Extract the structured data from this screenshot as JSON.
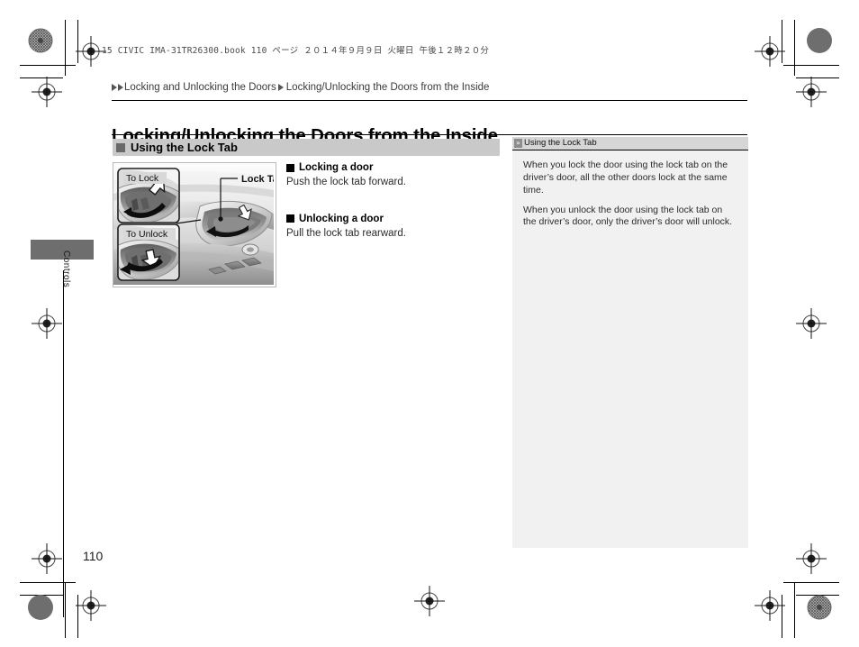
{
  "meta": {
    "running_head": "15 CIVIC IMA-31TR26300.book   110 ページ   ２０１４年９月９日   火曜日   午後１２時２０分",
    "folio": "110",
    "thumb_tab_label": "Controls"
  },
  "breadcrumb": {
    "parent": "Locking and Unlocking the Doors",
    "current": "Locking/Unlocking the Doors from the Inside"
  },
  "page_title": "Locking/Unlocking the Doors from the Inside",
  "section": {
    "header": "Using the Lock Tab"
  },
  "illustration": {
    "caption_lock_tab": "Lock Tab",
    "callout_to_lock": "To Lock",
    "callout_to_unlock": "To Unlock"
  },
  "body": {
    "items": [
      {
        "heading": "Locking a door",
        "text": "Push the lock tab forward."
      },
      {
        "heading": "Unlocking a door",
        "text": "Pull the lock tab rearward."
      }
    ]
  },
  "sidebar": {
    "header": "Using the Lock Tab",
    "header_icon": "double-chevron-right-icon",
    "paragraphs": [
      "When you lock the door using the lock tab on the driver’s door, all the other doors lock at the same time.",
      "When you unlock the door using the lock tab on the driver’s door, only the driver’s door will unlock."
    ]
  },
  "colors": {
    "section_header_bg": "#c9c9c9",
    "sidebar_bg": "#f1f1f1",
    "sidebar_header_bg": "#d6d6d6",
    "thumb_tab": "#6e6e6e"
  }
}
